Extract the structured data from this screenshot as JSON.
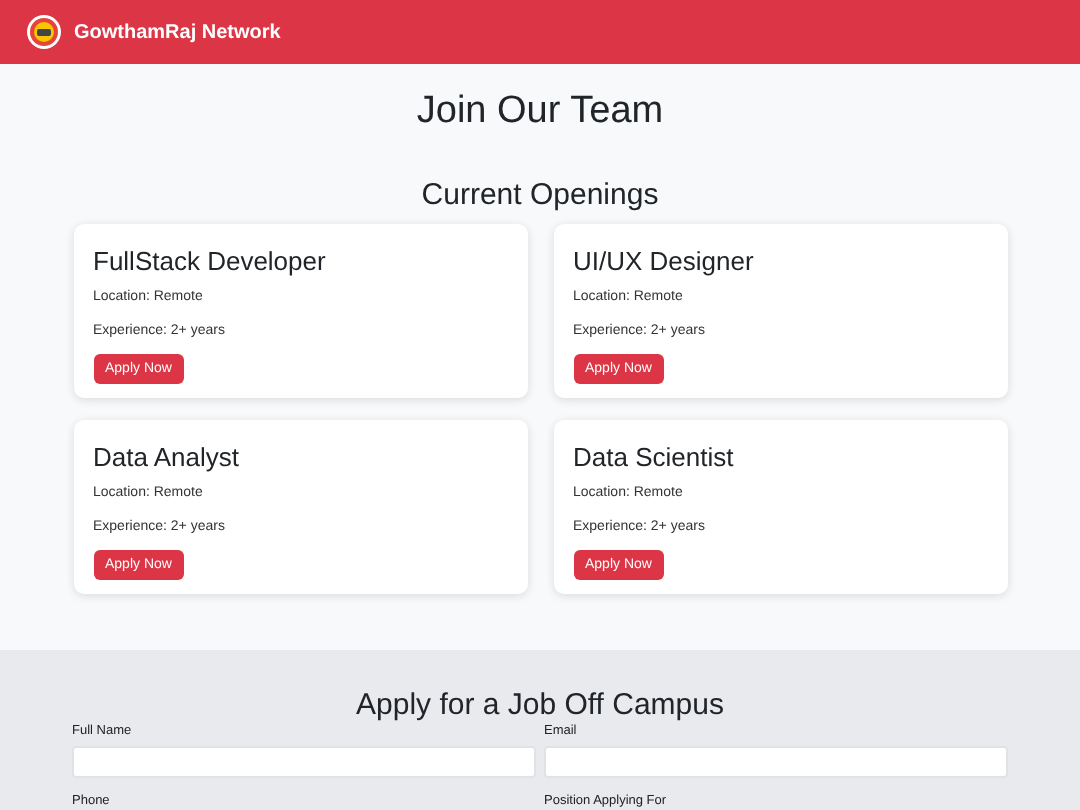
{
  "header": {
    "brand": "GowthamRaj Network"
  },
  "hero": {
    "title": "Join Our Team"
  },
  "openings": {
    "title": "Current Openings",
    "jobs": [
      {
        "title": "FullStack Developer",
        "location": "Location: Remote",
        "experience": "Experience: 2+ years",
        "button": "Apply Now"
      },
      {
        "title": "UI/UX Designer",
        "location": "Location: Remote",
        "experience": "Experience: 2+ years",
        "button": "Apply Now"
      },
      {
        "title": "Data Analyst",
        "location": "Location: Remote",
        "experience": "Experience: 2+ years",
        "button": "Apply Now"
      },
      {
        "title": "Data Scientist",
        "location": "Location: Remote",
        "experience": "Experience: 2+ years",
        "button": "Apply Now"
      }
    ]
  },
  "form": {
    "title": "Apply for a Job Off Campus",
    "fields": [
      {
        "label": "Full Name"
      },
      {
        "label": "Email"
      },
      {
        "label": "Phone"
      },
      {
        "label": "Position Applying For"
      }
    ]
  }
}
